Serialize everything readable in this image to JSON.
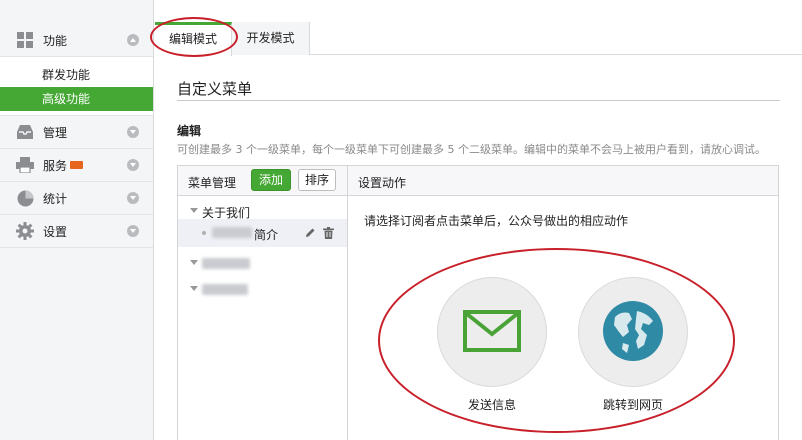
{
  "sidebar": {
    "sections": [
      {
        "label": "功能",
        "icon": "grid-icon"
      },
      {
        "label": "管理",
        "icon": "inbox-icon"
      },
      {
        "label": "服务",
        "icon": "printer-icon"
      },
      {
        "label": "统计",
        "icon": "pie-chart-icon"
      },
      {
        "label": "设置",
        "icon": "gear-icon"
      }
    ],
    "sub_items": [
      {
        "label": "群发功能",
        "active": false
      },
      {
        "label": "高级功能",
        "active": true
      }
    ]
  },
  "tabs": [
    {
      "label": "编辑模式",
      "active": true
    },
    {
      "label": "开发模式",
      "active": false
    }
  ],
  "main": {
    "title": "自定义菜单",
    "section_title": "编辑",
    "hint": "可创建最多 3 个一级菜单，每个一级菜单下可创建最多 5 个二级菜单。编辑中的菜单不会马上被用户看到，请放心调试。"
  },
  "menu_panel": {
    "header_label": "菜单管理",
    "add_button": "添加",
    "sort_button": "排序",
    "items": [
      {
        "label": "关于我们"
      }
    ],
    "sub_item_label": "简介"
  },
  "action_panel": {
    "header_label": "设置动作",
    "prompt": "请选择订阅者点击菜单后，公众号做出的相应动作",
    "actions": [
      {
        "label": "发送信息",
        "icon": "envelope-icon"
      },
      {
        "label": "跳转到网页",
        "icon": "globe-icon"
      }
    ]
  },
  "colors": {
    "accent_green": "#45a834",
    "highlight_red": "#c8202a",
    "badge_orange": "#e8651d"
  }
}
